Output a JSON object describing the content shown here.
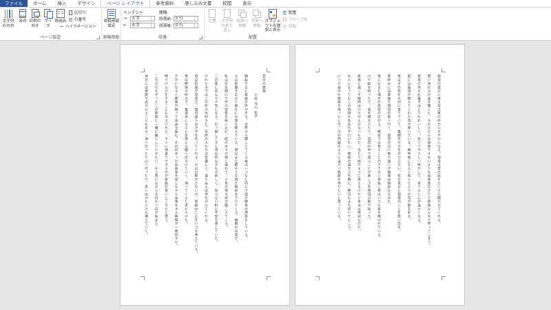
{
  "tabs": [
    "ファイル",
    "ホーム",
    "挿入",
    "デザイン",
    "ページ レイアウト",
    "参考資料",
    "差し込み文書",
    "校閲",
    "表示"
  ],
  "active_tab_index": 4,
  "ribbon": {
    "page_setup": {
      "label": "ページ設定",
      "text_direction": "文字列の方向",
      "margins": "余白",
      "orientation": "印刷の向き",
      "size": "サイズ",
      "columns": "段組み",
      "breaks": "区切り",
      "line_numbers": "行番号",
      "hyphenation": "ハイフネーション"
    },
    "genko": {
      "label": "原稿用紙",
      "button": "原稿用紙設定"
    },
    "paragraph": {
      "label": "段落",
      "indent_heading": "インデント",
      "spacing_heading": "間隔",
      "indent_start": "0 字",
      "indent_end": "0 字",
      "space_before_label": "段落前:",
      "space_after_label": "段落後:",
      "space_before": "0 行",
      "space_after": "0 行"
    },
    "arrange": {
      "label": "配置",
      "position": "位置",
      "wrap_text": "文字列の折り返し",
      "bring_forward": "前面へ移動",
      "send_backward": "背面へ移動",
      "selection_pane": "オブジェクトの選択と表示",
      "align": "配置",
      "group": "グループ化",
      "rotate": "回転"
    }
  },
  "page1": {
    "title": "自分の家族",
    "author": "小説 浅川 松子",
    "paragraphs": [
      "朝起きると家族の声がする。台所から聞こえてくる音はいつもと同じで母が朝食の用意をしている。",
      "父は新聞を広げて静かにお茶を飲んでいる。弟はまだ眠そうな顔で階段を下りてくる。毎朝の光景だ。",
      "私は窓を開けて外の空気を吸い込む。庭の木々が風に揺れて、小鳥の鳴き声が聞こえてくる。",
      "この家に住んで十年になる。引っ越してきた頃は何もかもが新しく、知らない町に不安を感じていた。",
      "けれど今ではこの町が大好きだ。近所の人たちは皆優しく、道で会えば声をかけてくれる。",
      "母は料理が得意で、毎日違うおかずを作ってくれる。父は口数が少ないが、家族のことをいつも考えている。",
      "弟は野球が好きで、毎週末になると友達と公園へ出かけていく。帰ってくると泥だらけだ。",
      "夕方になると家族が揃って食卓を囲む。その日あった出来事を話しながら食事をする時間が一番好きだ。",
      "時々けんかをすることもあるけれど、すぐに仲直りできるのが家族の良いところだと思う。",
      "これからもずっとこの家族と一緒に暮らしていきたい。そう思いながら今日も一日が始まる。",
      "休日には家族で出かけることもある。海へ行ったり山へ行ったり、思い出がたくさん増えていく。"
    ]
  },
  "page2": {
    "paragraphs": [
      "祖母が遊びに来る日は家の中がにぎやかになる。祖母は昔の話をたくさん聞かせてくれる。",
      "若い頃の父の話を聞くと、今の父からは想像できないような出来事ばかりで家族みんなで笑ってしまう。",
      "祖母の作るお菓子はとてもおいしい。甘くてやさしい味がして、食べると心が温かくなる。",
      "庭には祖母が植えてくれた花が咲いている。毎年春になると色とりどりの花が庭を彩る。",
      "母はその花を大切に育てていて、毎朝水やりを欠かさない。花を見ると祖母のことを思い出す。",
      "夏休みには家族で祖母の家へ行く。田舎の広い家で過ごす時間は特別なものだ。",
      "夜になると満天の星空が広がる。都会では見ることのできない景色に弟はいつも目を輝かせている。",
      "川で魚を釣ったり、虫を捕まえたり、自然の中で遊ぶことの楽しさを祖母の家で知った。",
      "家族と過ごす時間はかけがえのないものだ。当たり前のように思えるけれど本当は特別なのだ。",
      "大人になってもこの気持ちを忘れずにいたい。家族の温かさを胸に、明日もまた歩いていこう。",
      "いつか自分も家族を持ったとき、今の両親のように温かい家庭を作りたいと思っている。"
    ]
  }
}
